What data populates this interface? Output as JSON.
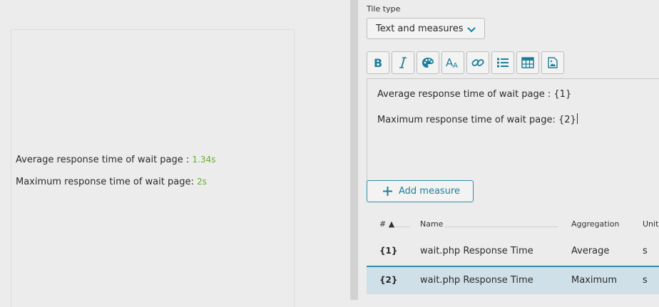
{
  "preview": {
    "line1_label": "Average response time of wait page : ",
    "line1_value": "1.34s",
    "line2_label": "Maximum response time of wait page: ",
    "line2_value": "2s"
  },
  "editor": {
    "tile_type_label": "Tile type",
    "tile_type_value": "Text and measures",
    "toolbar": [
      {
        "icon": "bold-icon"
      },
      {
        "icon": "italic-icon"
      },
      {
        "icon": "palette-icon"
      },
      {
        "icon": "font-size-icon"
      },
      {
        "icon": "link-icon"
      },
      {
        "icon": "list-icon"
      },
      {
        "icon": "table-icon"
      },
      {
        "icon": "image-icon"
      }
    ],
    "text_line1": "Average response time of wait page : {1}",
    "text_line2": "Maximum response time of wait page: {2}",
    "add_measure_label": "Add measure"
  },
  "measures_table": {
    "headers": {
      "num": "# ▲",
      "name": "Name",
      "aggregation": "Aggregation",
      "unit": "Unit"
    },
    "rows": [
      {
        "num": "{1}",
        "name": "wait.php Response Time",
        "aggregation": "Average",
        "unit": "s",
        "selected": false
      },
      {
        "num": "{2}",
        "name": "wait.php Response Time",
        "aggregation": "Maximum",
        "unit": "s",
        "selected": true
      }
    ]
  },
  "colors": {
    "accent": "#1c7f9a",
    "value_green": "#6bab2e",
    "selected_row": "#cfe0e8"
  }
}
